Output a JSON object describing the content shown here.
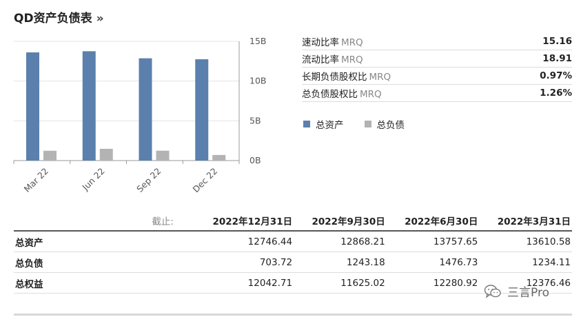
{
  "title": "QD资产负债表",
  "title_arrow": "»",
  "ratios": [
    {
      "label": "速动比率",
      "suffix": "MRQ",
      "value": "15.16"
    },
    {
      "label": "流动比率",
      "suffix": "MRQ",
      "value": "18.91"
    },
    {
      "label": "长期负债股权比",
      "suffix": "MRQ",
      "value": "0.97%"
    },
    {
      "label": "总负债股权比",
      "suffix": "MRQ",
      "value": "1.26%"
    }
  ],
  "legend": [
    {
      "name": "总资产",
      "color": "#5b80ad"
    },
    {
      "name": "总负债",
      "color": "#b3b3b3"
    }
  ],
  "chart_data": {
    "type": "bar",
    "categories": [
      "Mar 22",
      "Jun 22",
      "Sep 22",
      "Dec 22"
    ],
    "series": [
      {
        "name": "总资产",
        "color": "#5b80ad",
        "values": [
          13610.58,
          13757.65,
          12868.21,
          12746.44
        ]
      },
      {
        "name": "总负债",
        "color": "#b3b3b3",
        "values": [
          1234.11,
          1476.73,
          1243.18,
          703.72
        ]
      }
    ],
    "yticks": [
      "0B",
      "5B",
      "10B",
      "15B"
    ],
    "ylim": [
      0,
      15000
    ],
    "ytick_values": [
      0,
      5000,
      10000,
      15000
    ]
  },
  "table": {
    "as_of_label": "截止:",
    "columns": [
      "2022年12月31日",
      "2022年9月30日",
      "2022年6月30日",
      "2022年3月31日"
    ],
    "rows": [
      {
        "label": "总资产",
        "values": [
          "12746.44",
          "12868.21",
          "13757.65",
          "13610.58"
        ]
      },
      {
        "label": "总负债",
        "values": [
          "703.72",
          "1243.18",
          "1476.73",
          "1234.11"
        ]
      },
      {
        "label": "总权益",
        "values": [
          "12042.71",
          "11625.02",
          "12280.92",
          "12376.46"
        ]
      }
    ]
  },
  "watermark": "三言Pro",
  "watermark_icon": "wechat-icon"
}
